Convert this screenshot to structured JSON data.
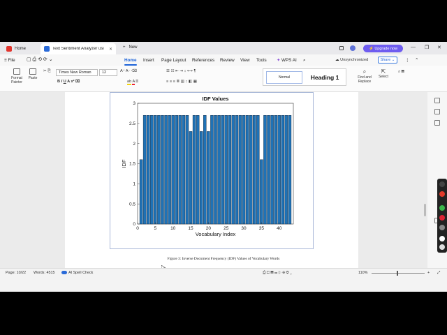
{
  "tabs": {
    "home_label": "Home",
    "doc_label": "Text Sentiment Analyzer usi",
    "new_label": "New"
  },
  "titlebar": {
    "upgrade_label": "Upgrade now"
  },
  "menu": {
    "file": "File",
    "items": [
      "Home",
      "Insert",
      "Page Layout",
      "References",
      "Review",
      "View",
      "Tools",
      "WPS AI"
    ],
    "unsync": "Unsynchronized",
    "share": "Share"
  },
  "ribbon": {
    "format_painter": "Format Painter",
    "paste": "Paste",
    "font_name": "Times New Roman",
    "font_size": "12",
    "style_normal": "Normal",
    "style_heading": "Heading 1",
    "find_replace": "Find and Replace",
    "select": "Select"
  },
  "colors": {
    "bar": "#1f72b6",
    "bar_edge": "#0a1f33",
    "accent": "#1c62d8",
    "upgrade": "#6e5cf0"
  },
  "chart_data": {
    "type": "bar",
    "title": "IDF Values",
    "xlabel": "Vocabulary Index",
    "ylabel": "IDF",
    "xlim": [
      0,
      44
    ],
    "ylim": [
      0,
      3
    ],
    "xticks": [
      0,
      5,
      10,
      15,
      20,
      25,
      30,
      35,
      40
    ],
    "yticks": [
      0,
      0.5,
      1,
      1.5,
      2,
      2.5,
      3
    ],
    "ytick_labels": [
      "0",
      "0.5",
      "1",
      "1.5",
      "2",
      "2.5",
      "3"
    ],
    "x": [
      1,
      2,
      3,
      4,
      5,
      6,
      7,
      8,
      9,
      10,
      11,
      12,
      13,
      14,
      15,
      16,
      17,
      18,
      19,
      20,
      21,
      22,
      23,
      24,
      25,
      26,
      27,
      28,
      29,
      30,
      31,
      32,
      33,
      34,
      35,
      36,
      37,
      38,
      39,
      40,
      41,
      42,
      43
    ],
    "values": [
      1.6,
      2.7,
      2.7,
      2.7,
      2.7,
      2.7,
      2.7,
      2.7,
      2.7,
      2.7,
      2.7,
      2.7,
      2.7,
      2.7,
      2.3,
      2.7,
      2.7,
      2.3,
      2.7,
      2.3,
      2.7,
      2.7,
      2.7,
      2.7,
      2.7,
      2.7,
      2.7,
      2.7,
      2.7,
      2.7,
      2.7,
      2.7,
      2.7,
      2.7,
      1.6,
      2.7,
      2.7,
      2.7,
      2.7,
      2.7,
      2.7,
      2.7,
      2.7
    ],
    "grid": false
  },
  "caption": "Figure 3: Inverse Document Frequency (IDF) Values of Vocabulary Words",
  "status": {
    "page": "Page: 10/22",
    "words": "Words: 4515",
    "spell": "AI Spell Check",
    "zoom": "110%"
  }
}
